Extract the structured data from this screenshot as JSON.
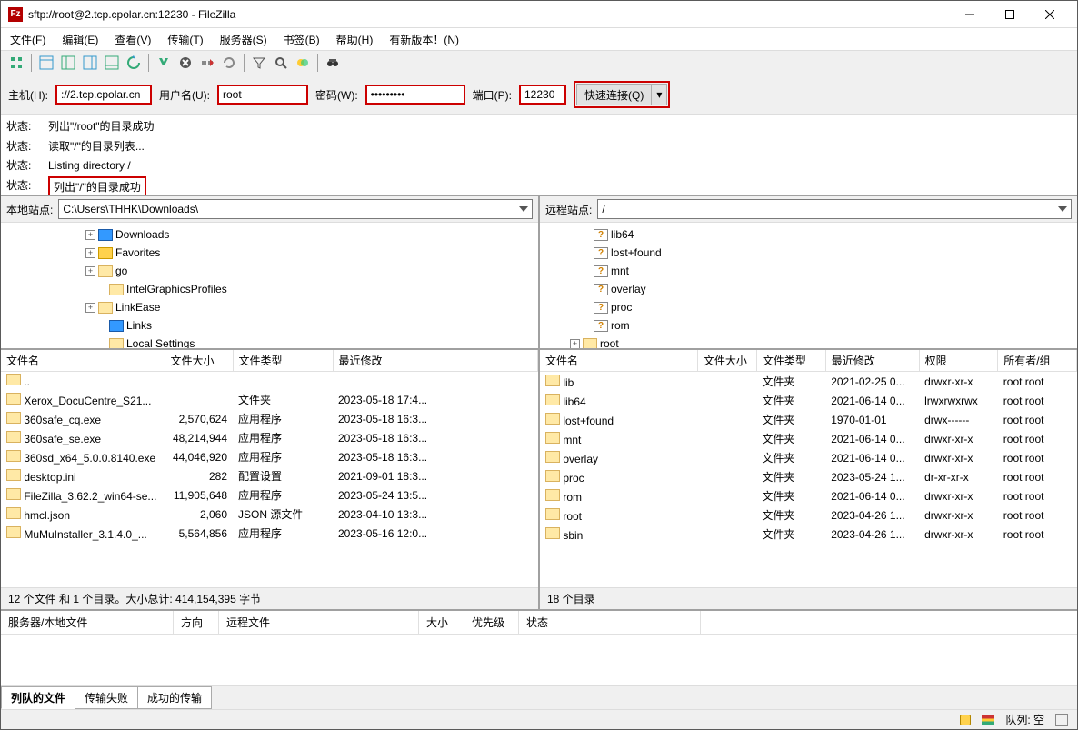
{
  "title": "sftp://root@2.tcp.cpolar.cn:12230 - FileZilla",
  "menu": [
    "文件(F)",
    "编辑(E)",
    "查看(V)",
    "传输(T)",
    "服务器(S)",
    "书签(B)",
    "帮助(H)",
    "有新版本！(N)"
  ],
  "connect": {
    "host_lbl": "主机(H):",
    "host": "://2.tcp.cpolar.cn",
    "user_lbl": "用户名(U):",
    "user": "root",
    "pass_lbl": "密码(W):",
    "pass": "•••••••••",
    "port_lbl": "端口(P):",
    "port": "12230",
    "quick": "快速连接(Q)"
  },
  "log_lbl": "状态:",
  "log": [
    "列出\"/root\"的目录成功",
    "读取\"/\"的目录列表...",
    "Listing directory /",
    "列出\"/\"的目录成功"
  ],
  "local": {
    "label": "本地站点:",
    "path": "C:\\Users\\THHK\\Downloads\\",
    "tree": [
      {
        "indent": 90,
        "tw": "+",
        "icon": "blue",
        "label": "Downloads"
      },
      {
        "indent": 90,
        "tw": "+",
        "icon": "star",
        "label": "Favorites"
      },
      {
        "indent": 90,
        "tw": "+",
        "icon": "f",
        "label": "go"
      },
      {
        "indent": 102,
        "tw": "",
        "icon": "f",
        "label": "IntelGraphicsProfiles"
      },
      {
        "indent": 90,
        "tw": "+",
        "icon": "f",
        "label": "LinkEase"
      },
      {
        "indent": 102,
        "tw": "",
        "icon": "blue",
        "label": "Links"
      },
      {
        "indent": 102,
        "tw": "",
        "icon": "f",
        "label": "Local Settings"
      }
    ],
    "cols": [
      "文件名",
      "文件大小",
      "文件类型",
      "最近修改"
    ],
    "files": [
      {
        "n": "..",
        "s": "",
        "t": "",
        "m": ""
      },
      {
        "n": "Xerox_DocuCentre_S21...",
        "s": "",
        "t": "文件夹",
        "m": "2023-05-18 17:4..."
      },
      {
        "n": "360safe_cq.exe",
        "s": "2,570,624",
        "t": "应用程序",
        "m": "2023-05-18 16:3..."
      },
      {
        "n": "360safe_se.exe",
        "s": "48,214,944",
        "t": "应用程序",
        "m": "2023-05-18 16:3..."
      },
      {
        "n": "360sd_x64_5.0.0.8140.exe",
        "s": "44,046,920",
        "t": "应用程序",
        "m": "2023-05-18 16:3..."
      },
      {
        "n": "desktop.ini",
        "s": "282",
        "t": "配置设置",
        "m": "2021-09-01 18:3..."
      },
      {
        "n": "FileZilla_3.62.2_win64-se...",
        "s": "11,905,648",
        "t": "应用程序",
        "m": "2023-05-24 13:5..."
      },
      {
        "n": "hmcl.json",
        "s": "2,060",
        "t": "JSON 源文件",
        "m": "2023-04-10 13:3..."
      },
      {
        "n": "MuMuInstaller_3.1.4.0_...",
        "s": "5,564,856",
        "t": "应用程序",
        "m": "2023-05-16 12:0..."
      }
    ],
    "status": "12 个文件 和 1 个目录。大小总计: 414,154,395 字节"
  },
  "remote": {
    "label": "远程站点:",
    "path": "/",
    "tree": [
      {
        "indent": 42,
        "tw": "",
        "icon": "q",
        "label": "lib64"
      },
      {
        "indent": 42,
        "tw": "",
        "icon": "q",
        "label": "lost+found"
      },
      {
        "indent": 42,
        "tw": "",
        "icon": "q",
        "label": "mnt"
      },
      {
        "indent": 42,
        "tw": "",
        "icon": "q",
        "label": "overlay"
      },
      {
        "indent": 42,
        "tw": "",
        "icon": "q",
        "label": "proc"
      },
      {
        "indent": 42,
        "tw": "",
        "icon": "q",
        "label": "rom"
      },
      {
        "indent": 30,
        "tw": "+",
        "icon": "f",
        "label": "root"
      }
    ],
    "cols": [
      "文件名",
      "文件大小",
      "文件类型",
      "最近修改",
      "权限",
      "所有者/组"
    ],
    "files": [
      {
        "n": "lib",
        "s": "",
        "t": "文件夹",
        "m": "2021-02-25 0...",
        "p": "drwxr-xr-x",
        "o": "root root"
      },
      {
        "n": "lib64",
        "s": "",
        "t": "文件夹",
        "m": "2021-06-14 0...",
        "p": "lrwxrwxrwx",
        "o": "root root"
      },
      {
        "n": "lost+found",
        "s": "",
        "t": "文件夹",
        "m": "1970-01-01",
        "p": "drwx------",
        "o": "root root"
      },
      {
        "n": "mnt",
        "s": "",
        "t": "文件夹",
        "m": "2021-06-14 0...",
        "p": "drwxr-xr-x",
        "o": "root root"
      },
      {
        "n": "overlay",
        "s": "",
        "t": "文件夹",
        "m": "2021-06-14 0...",
        "p": "drwxr-xr-x",
        "o": "root root"
      },
      {
        "n": "proc",
        "s": "",
        "t": "文件夹",
        "m": "2023-05-24 1...",
        "p": "dr-xr-xr-x",
        "o": "root root"
      },
      {
        "n": "rom",
        "s": "",
        "t": "文件夹",
        "m": "2021-06-14 0...",
        "p": "drwxr-xr-x",
        "o": "root root"
      },
      {
        "n": "root",
        "s": "",
        "t": "文件夹",
        "m": "2023-04-26 1...",
        "p": "drwxr-xr-x",
        "o": "root root"
      },
      {
        "n": "sbin",
        "s": "",
        "t": "文件夹",
        "m": "2023-04-26 1...",
        "p": "drwxr-xr-x",
        "o": "root root"
      }
    ],
    "status": "18 个目录"
  },
  "queue_cols": [
    "服务器/本地文件",
    "方向",
    "远程文件",
    "大小",
    "优先级",
    "状态"
  ],
  "tabs": [
    "列队的文件",
    "传输失败",
    "成功的传输"
  ],
  "statusbar": {
    "queue": "队列: 空"
  }
}
